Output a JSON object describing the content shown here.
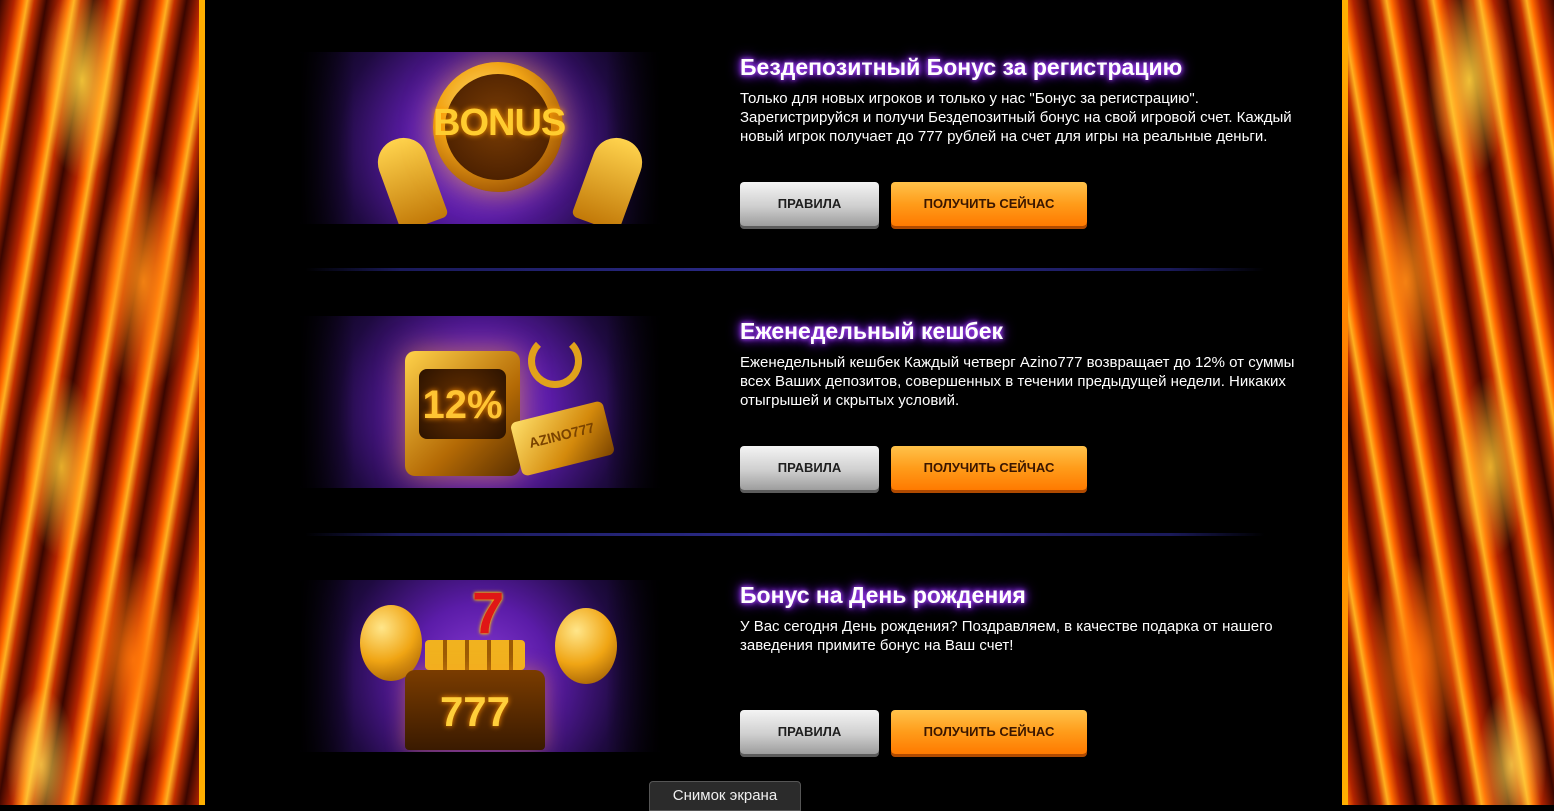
{
  "promos": [
    {
      "title": "Бездепозитный Бонус за регистрацию",
      "description": "Только для новых игроков и только у нас \"Бонус за регистрацию\". Зарегистрируйся и получи Бездепозитный бонус на свой игровой счет. Каждый новый игрок получает до 777 рублей на счет для игры на реальные деньги.",
      "banner_text": "BONUS",
      "rules_label": "ПРАВИЛА",
      "get_label": "ПОЛУЧИТЬ СЕЙЧАС"
    },
    {
      "title": "Еженедельный кешбек",
      "description": "Еженедельный кешбек Каждый четверг Azino777 возвращает до 12% от суммы всех Ваших депозитов, совершенных в течении предыдущей недели. Никаких отыгрышей и скрытых условий.",
      "banner_text": "12%",
      "banner_subtext": "AZINO777",
      "rules_label": "ПРАВИЛА",
      "get_label": "ПОЛУЧИТЬ СЕЙЧАС"
    },
    {
      "title": "Бонус на День рождения",
      "description": "У Вас сегодня День рождения? Поздравляем, в качестве подарка от нашего заведения примите бонус на Ваш счет!",
      "banner_text": "777",
      "banner_subtext": "7",
      "rules_label": "ПРАВИЛА",
      "get_label": "ПОЛУЧИТЬ СЕЙЧАС"
    }
  ],
  "tooltip": "Снимок экрана",
  "colors": {
    "title_glow": "#8f2bff",
    "button_orange": "#ff9c1a",
    "button_gray": "#cfcfcf",
    "fire": "#ff6a00"
  },
  "icons": [
    "bonus-coin-icon",
    "safe-icon",
    "birthday-cake-icon"
  ]
}
